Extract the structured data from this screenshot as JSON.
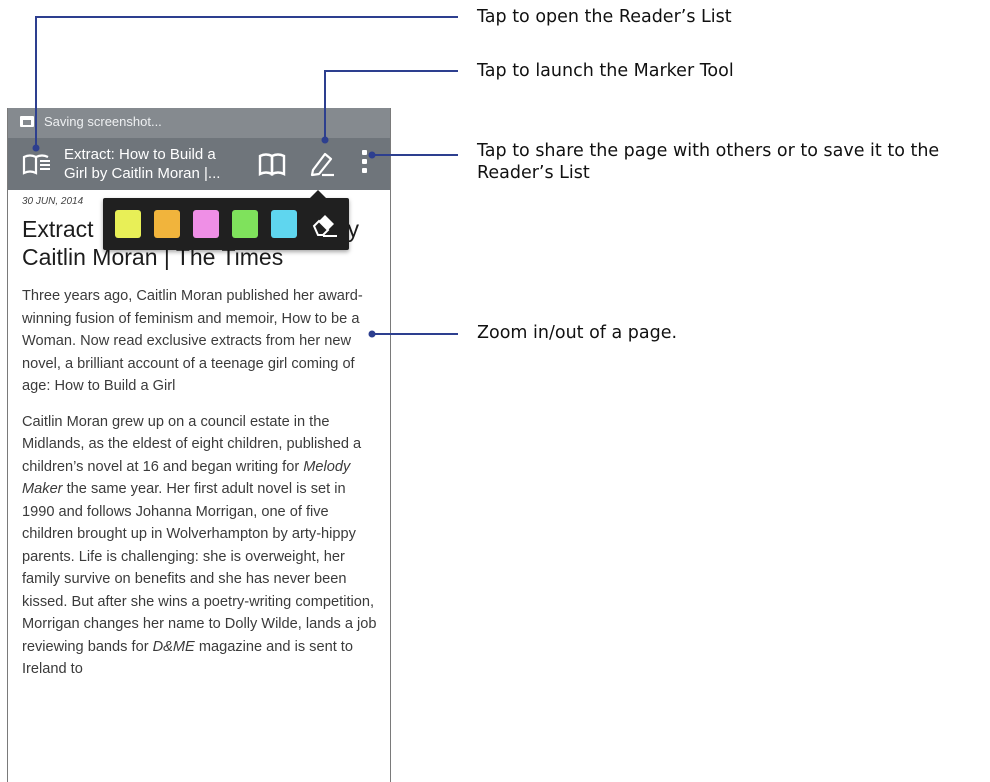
{
  "status_bar": {
    "text": "Saving screenshot..."
  },
  "app_bar": {
    "title_line1": "Extract: How to Build a",
    "title_line2": "Girl by Caitlin Moran |...",
    "icons": [
      "readers-list-icon",
      "book-icon",
      "marker-icon",
      "more-options-icon"
    ]
  },
  "article": {
    "date": "30 JUN, 2014",
    "title_line1_start": "Extract",
    "title_line1_end": "y",
    "title_line2": "Caitlin Moran | The Times",
    "para1": "Three years ago, Caitlin Moran published her award-winning fusion of feminism and memoir, How to be a Woman. Now read exclusive extracts from her new novel, a brilliant account of a teenage girl coming of age: How to Build a Girl",
    "para2_a": "Caitlin Moran grew up on a council estate in the Midlands, as the eldest of eight children, published a children’s novel at 16 and began writing for ",
    "para2_em1": "Melody Maker",
    "para2_b": " the same year. Her first adult novel is set in 1990 and follows Johanna Morrigan, one of five children brought up in Wolverhampton by arty-hippy parents. Life is challenging: she is overweight, her family survive on benefits and she has never been kissed. But after she wins a poetry-writing competition, Morrigan changes her name to Dolly Wilde, lands a job reviewing bands for ",
    "para2_em2": "D&ME",
    "para2_c": " magazine and is sent to Ireland to"
  },
  "palette": {
    "swatches": [
      {
        "name": "yellow",
        "color": "#e8ef57"
      },
      {
        "name": "orange",
        "color": "#f1b43c"
      },
      {
        "name": "pink",
        "color": "#ef8fe6"
      },
      {
        "name": "green",
        "color": "#7fe25c"
      },
      {
        "name": "cyan",
        "color": "#5fd6ef"
      }
    ],
    "eraser_icon": "eraser-icon"
  },
  "callouts": {
    "readers_list": "Tap to open the Reader’s List",
    "marker_tool": "Tap to launch the Marker Tool",
    "share_line1": "Tap to share the page with others or to save it to the",
    "share_line2": "Reader’s List",
    "zoom": "Zoom in/out of a page."
  },
  "colors": {
    "status_bar": "#858a8f",
    "app_bar": "#6f757b",
    "callout_line": "#2d3f8f",
    "palette_bg": "#202020"
  }
}
